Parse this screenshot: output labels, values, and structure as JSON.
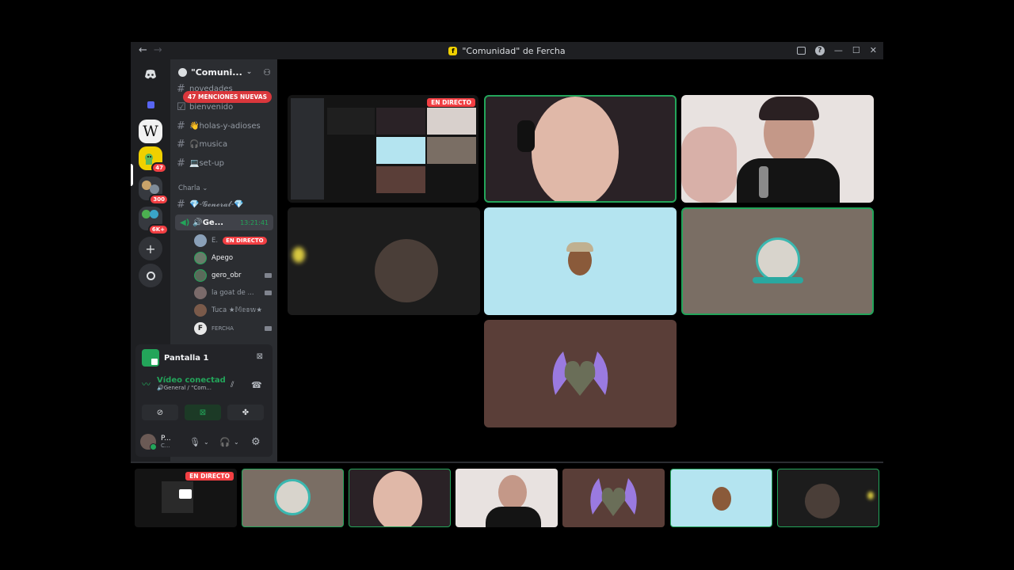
{
  "titlebar": {
    "back": "←",
    "forward": "→",
    "server_initial": "f",
    "title": "\"Comunidad\" de Fercha"
  },
  "rail": {
    "servers": [
      {
        "name": "discord-home"
      },
      {
        "name": "folder",
        "color": "#5865f2"
      },
      {
        "name": "wikipedia",
        "letter": "W"
      },
      {
        "name": "server-47",
        "badge": "47"
      },
      {
        "name": "server-300",
        "badge": "300"
      },
      {
        "name": "server-6k",
        "badge": "6K+"
      }
    ]
  },
  "sidebar": {
    "server_name": "\"Comuni...",
    "mentions_pill": "47 MENCIONES NUEVAS",
    "channels": [
      {
        "label": "novedades"
      },
      {
        "label": "bienvenido"
      },
      {
        "label": "👋holas-y-adioses"
      },
      {
        "label": "🎧musica"
      },
      {
        "label": "💻set-up"
      }
    ],
    "category": "Charla",
    "general_channel": "💎-𝓖𝓮𝓷𝓮𝓻𝓪𝓵-💎",
    "voice_channel": {
      "name": "🔊Ge...",
      "timer": "13:21:41"
    },
    "voice_members": [
      {
        "name": "E.",
        "live": "EN DIRECTO",
        "color": "#8aa0b8"
      },
      {
        "name": "Apego",
        "color": "#6a7a6a"
      },
      {
        "name": "gero_obr",
        "color": "#5a6a5a"
      },
      {
        "name": "la goat de ...",
        "color": "#7a6a6a"
      },
      {
        "name": "Tuca ★𝕄𝕖𝕠𝕨★",
        "color": "#7a5a4a"
      },
      {
        "name": "FERCHA",
        "color": "#e8e8e8"
      }
    ]
  },
  "panel": {
    "screen_label": "Pantalla 1",
    "status": "Vídeo conectad",
    "location": "🔊General / \"Com...",
    "user_name": "P...",
    "user_status": "C..."
  },
  "stage": {
    "live_label": "EN DIRECTO",
    "tiles": [
      {
        "name": "screen-share",
        "bg": "#1a1a1a"
      },
      {
        "name": "streamer-boy-headphones",
        "bg": "#2a2226"
      },
      {
        "name": "boy-glasses-mic",
        "bg": "#e8e2e0"
      },
      {
        "name": "dark-room-cam",
        "bg": "#1c1c1c"
      },
      {
        "name": "avatar-cap-man",
        "bg": "#b4e4f0"
      },
      {
        "name": "avatar-horse-crystal",
        "bg": "#7a6e64"
      },
      {
        "name": "avatar-winged-heart",
        "bg": "#5a3e38"
      }
    ]
  },
  "strip_live": "EN DIRECTO"
}
